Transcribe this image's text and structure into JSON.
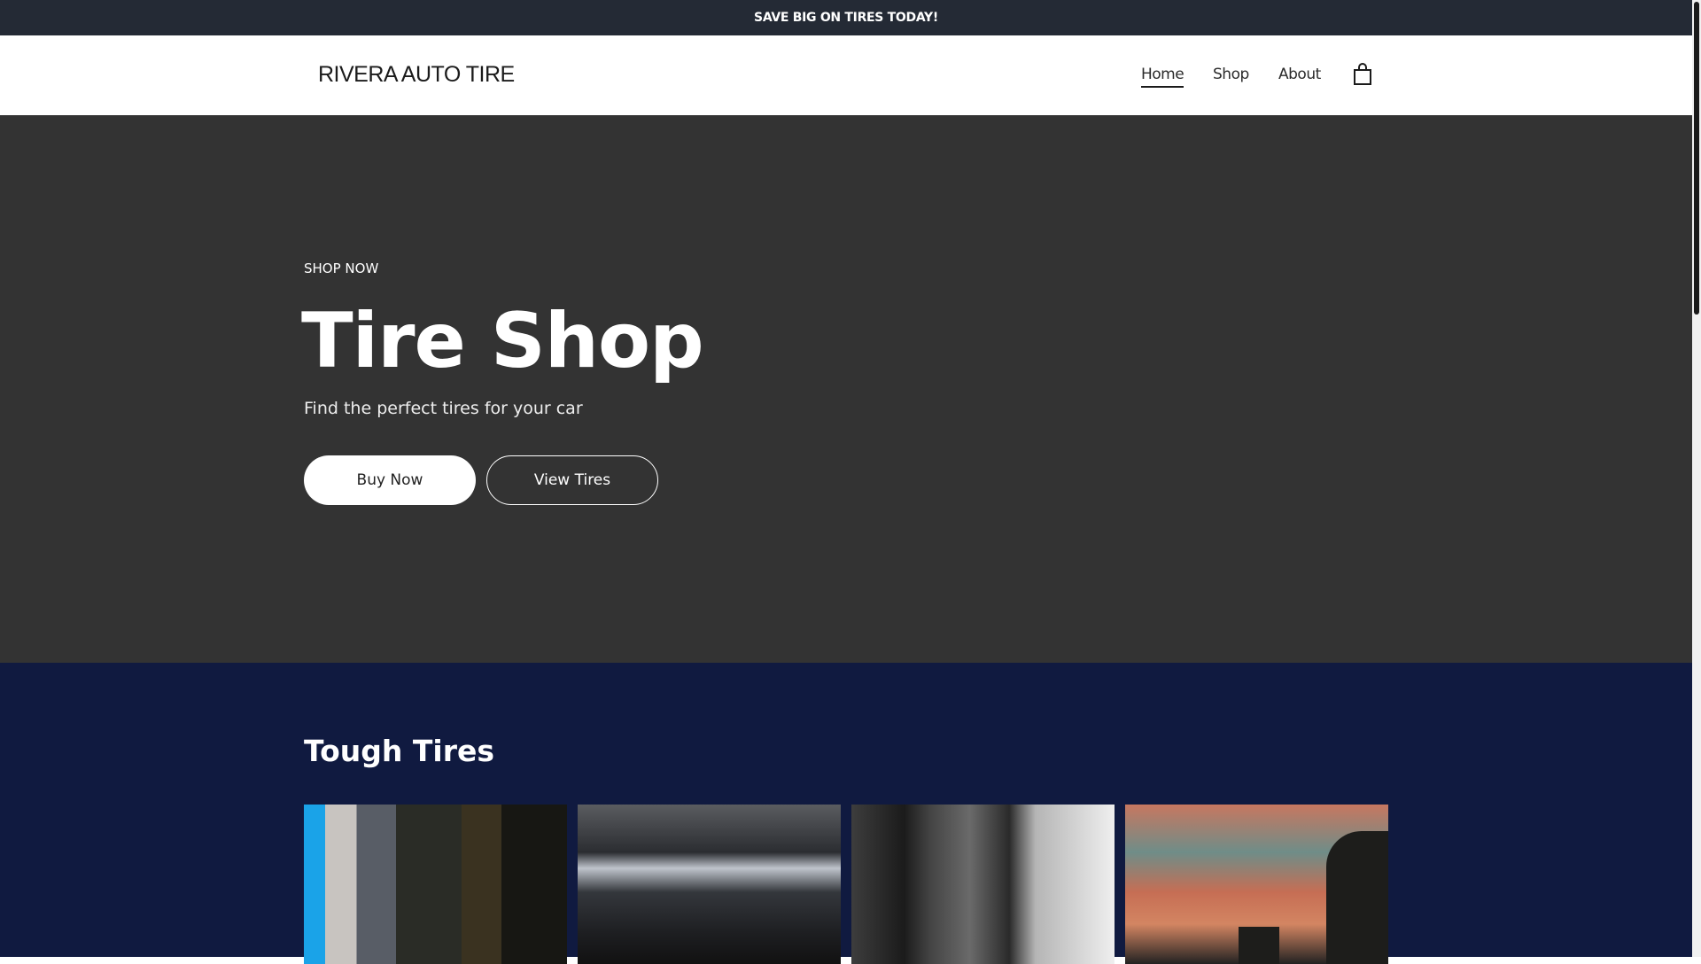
{
  "announcement": "SAVE BIG ON TIRES TODAY!",
  "header": {
    "logo": "RIVERA AUTO TIRE",
    "nav": [
      "Home",
      "Shop",
      "About"
    ],
    "active": "Home",
    "cart_icon": "shopping-bag-icon"
  },
  "hero": {
    "eyebrow": "SHOP NOW",
    "title": "Tire Shop",
    "subtitle": "Find the perfect tires for your car",
    "primary_button": "Buy Now",
    "secondary_button": "View Tires"
  },
  "section": {
    "title": "Tough Tires"
  },
  "colors": {
    "announcement_bg": "#242a35",
    "hero_bg": "#333333",
    "section_bg": "#101a40"
  }
}
